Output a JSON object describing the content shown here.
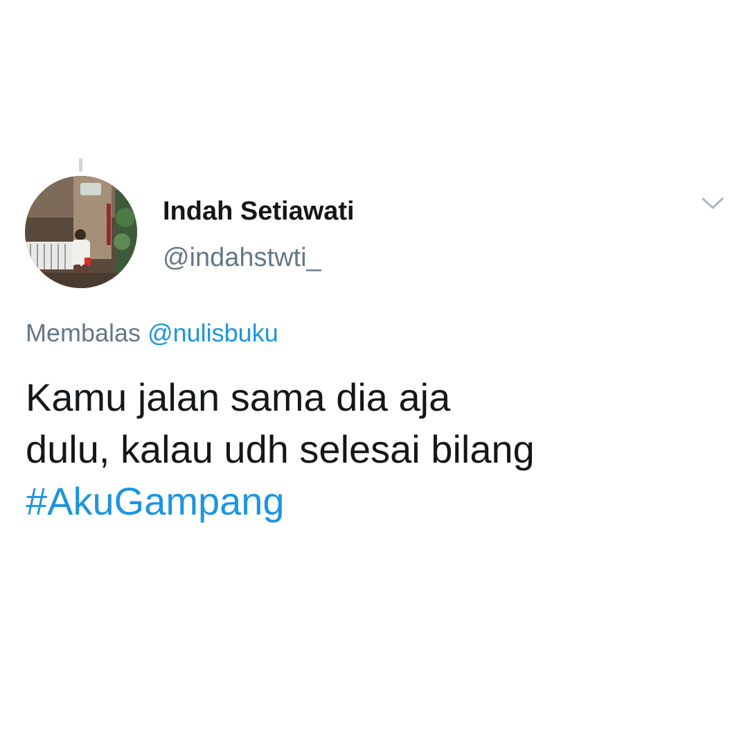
{
  "tweet": {
    "author": {
      "display_name": "Indah Setiawati",
      "handle": "@indahstwti_"
    },
    "reply": {
      "prefix": "Membalas",
      "mention": "@nulisbuku"
    },
    "text_lines": [
      "Kamu jalan sama dia aja",
      "dulu, kalau udh selesai bilang"
    ],
    "hashtag": "#AkuGampang"
  },
  "icons": {
    "menu": "chevron-down-icon",
    "avatar": "profile-photo"
  },
  "colors": {
    "link": "#1b95e0",
    "secondary_text": "#657786",
    "primary_text": "#14171a",
    "thread_line": "#ccd6dd"
  }
}
